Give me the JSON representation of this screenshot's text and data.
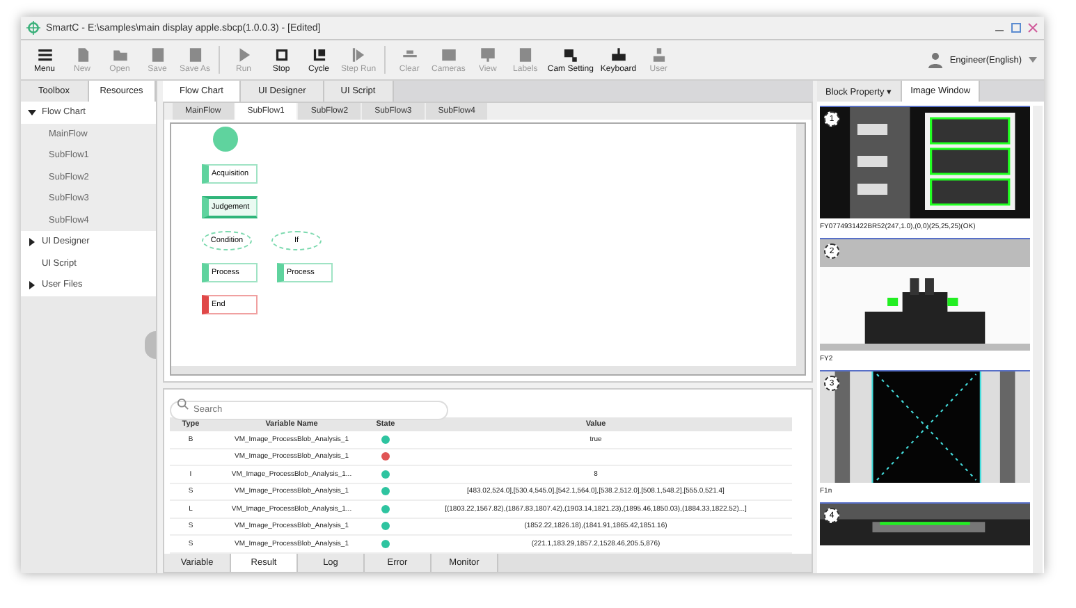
{
  "window": {
    "title": "SmartC - E:\\samples\\main display apple.sbcp(1.0.0.3) - [Edited]"
  },
  "toolbar": {
    "buttons": [
      {
        "label": "Menu",
        "disabled": false
      },
      {
        "label": "New",
        "disabled": true
      },
      {
        "label": "Open",
        "disabled": true
      },
      {
        "label": "Save",
        "disabled": true
      },
      {
        "label": "Save As",
        "disabled": true
      },
      {
        "label": "Run",
        "disabled": true
      },
      {
        "label": "Stop",
        "disabled": false
      },
      {
        "label": "Cycle",
        "disabled": false
      },
      {
        "label": "Step Run",
        "disabled": true
      },
      {
        "label": "Clear",
        "disabled": true
      },
      {
        "label": "Cameras",
        "disabled": true
      },
      {
        "label": "View",
        "disabled": true
      },
      {
        "label": "Labels",
        "disabled": true
      },
      {
        "label": "Cam Setting",
        "disabled": false
      },
      {
        "label": "Keyboard",
        "disabled": false
      },
      {
        "label": "User",
        "disabled": true
      }
    ],
    "login": "Engineer(English)"
  },
  "left_panel": {
    "tabs": [
      {
        "label": "Toolbox",
        "selected": false
      },
      {
        "label": "Resources",
        "selected": true
      }
    ],
    "tree": [
      {
        "label": "Flow Chart",
        "expanded": true,
        "children": [
          {
            "label": "MainFlow"
          },
          {
            "label": "SubFlow1"
          },
          {
            "label": "SubFlow2"
          },
          {
            "label": "SubFlow3"
          },
          {
            "label": "SubFlow4"
          }
        ]
      },
      {
        "label": "UI Designer",
        "expanded": false
      },
      {
        "label": "UI Script"
      },
      {
        "label": "User Files",
        "expanded": false
      }
    ]
  },
  "editor": {
    "tabs": [
      {
        "label": "Flow Chart",
        "selected": true
      },
      {
        "label": "UI Designer",
        "selected": false
      },
      {
        "label": "UI Script",
        "selected": false
      }
    ],
    "flow_tabs": [
      {
        "label": "MainFlow",
        "selected": false
      },
      {
        "label": "SubFlow1",
        "selected": true
      },
      {
        "label": "SubFlow2",
        "selected": false
      },
      {
        "label": "SubFlow3",
        "selected": false
      },
      {
        "label": "SubFlow4",
        "selected": false
      }
    ],
    "node_rows": [
      {
        "nodes": [
          {
            "kind": "start",
            "selected": false
          }
        ]
      },
      {
        "nodes": [
          {
            "kind": "process",
            "label": "Acquisition",
            "selected": false
          }
        ]
      },
      {
        "nodes": [
          {
            "kind": "process",
            "label": "Judgement",
            "selected": true
          }
        ]
      },
      {
        "nodes": [
          {
            "kind": "decision",
            "label": "Condition",
            "selected": false
          },
          {
            "kind": "decision",
            "label": "If",
            "selected": false
          }
        ]
      },
      {
        "nodes": [
          {
            "kind": "process",
            "label": "Process",
            "selected": false
          },
          {
            "kind": "process",
            "label": "Process",
            "selected": false
          }
        ]
      },
      {
        "nodes": [
          {
            "kind": "error",
            "label": "End",
            "selected": false
          }
        ]
      }
    ]
  },
  "variables": {
    "search": {
      "placeholder": "Search"
    },
    "columns": [
      "Type",
      "Variable Name",
      "State",
      "Value"
    ],
    "rows": [
      {
        "type": "B",
        "name": "VM_Image_ProcessBlob_Analysis_1",
        "color": "#2ec4a0",
        "value": "true"
      },
      {
        "type": "",
        "name": "VM_Image_ProcessBlob_Analysis_1",
        "color": "#e05555",
        "value": ""
      },
      {
        "type": "I",
        "name": "VM_Image_ProcessBlob_Analysis_1...",
        "color": "#2ec4a0",
        "value": "8"
      },
      {
        "type": "S",
        "name": "VM_Image_ProcessBlob_Analysis_1",
        "color": "#2ec4a0",
        "value": "[483.02,524.0],[530.4,545.0],[542.1,564.0],[538.2,512.0],[508.1,548.2],[555.0,521.4]"
      },
      {
        "type": "L",
        "name": "VM_Image_ProcessBlob_Analysis_1...",
        "color": "#2ec4a0",
        "value": "[(1803.22,1567.82),(1867.83,1807.42),(1903.14,1821.23),(1895.46,1850.03),(1884.33,1822.52)...]"
      },
      {
        "type": "S",
        "name": "VM_Image_ProcessBlob_Analysis_1",
        "color": "#2ec4a0",
        "value": "(1852.22,1826.18),(1841.91,1865.42,1851.16)"
      },
      {
        "type": "S",
        "name": "VM_Image_ProcessBlob_Analysis_1",
        "color": "#2ec4a0",
        "value": "(221.1,183.29,1857.2,1528.46,205.5,876)"
      }
    ],
    "tabs": [
      {
        "label": "Variable",
        "selected": false
      },
      {
        "label": "Result",
        "selected": true
      },
      {
        "label": "Log",
        "selected": false
      },
      {
        "label": "Error",
        "selected": false
      },
      {
        "label": "Monitor",
        "selected": false
      }
    ]
  },
  "right_panel": {
    "tabs": [
      {
        "label": "Block Property ▾",
        "selected": false
      },
      {
        "label": "Image Window",
        "selected": true
      }
    ],
    "images": [
      {
        "number": "1",
        "caption": "FY0774931422BR52(247,1.0),(0,0)(25,25,25)(OK)",
        "kind": "grid"
      },
      {
        "number": "2",
        "caption": "FY2",
        "kind": "part"
      },
      {
        "number": "3",
        "caption": "F1n",
        "kind": "cross"
      },
      {
        "number": "4",
        "kind": "strip"
      }
    ]
  }
}
